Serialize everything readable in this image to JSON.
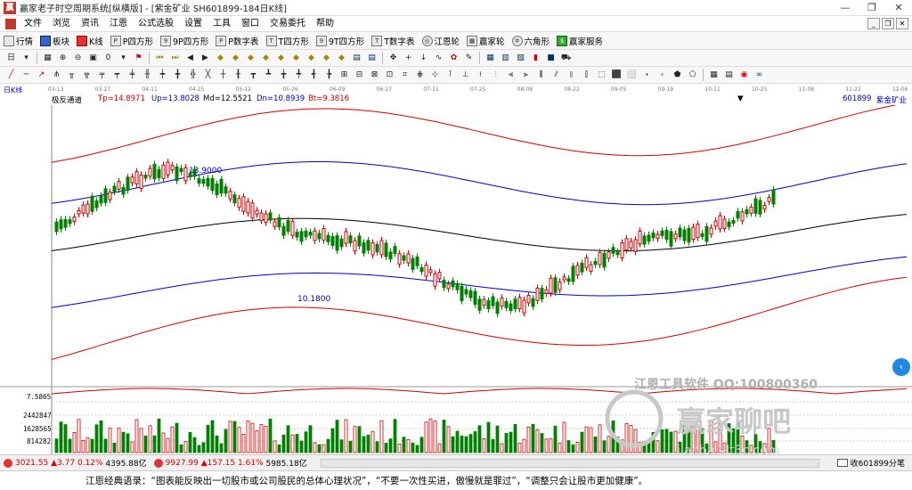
{
  "window": {
    "title": "赢家老子时空周期系统[纵横版] - [紫金矿业  SH601899-184日K线]",
    "app_logo": "赢",
    "buttons": [
      "—",
      "❐",
      "✕"
    ]
  },
  "menu": {
    "items": [
      "文件",
      "浏览",
      "资讯",
      "江恩",
      "公式选股",
      "设置",
      "工具",
      "窗口",
      "交易委托",
      "帮助"
    ],
    "mdi_buttons": [
      "_",
      "❐",
      "✕"
    ]
  },
  "toolbar1": {
    "items": [
      {
        "label": "行情",
        "icon": "grid-icon"
      },
      {
        "label": "板块",
        "icon": "block-icon"
      },
      {
        "label": "K线",
        "icon": "kline-icon"
      },
      {
        "label": "P四方形",
        "icon": "square-icon"
      },
      {
        "label": "9P四方形",
        "icon": "square9-icon"
      },
      {
        "label": "P数字表",
        "icon": "table-icon"
      },
      {
        "label": "T四方形",
        "icon": "tsquare-icon"
      },
      {
        "label": "9T四方形",
        "icon": "tsquare9-icon"
      },
      {
        "label": "T数字表",
        "icon": "ttable-icon"
      },
      {
        "label": "江恩轮",
        "icon": "wheel-icon"
      },
      {
        "label": "赢家轮",
        "icon": "wheel2-icon"
      },
      {
        "label": "六角形",
        "icon": "hexagon-icon"
      },
      {
        "label": "赢家服务",
        "icon": "dollar-icon"
      }
    ]
  },
  "toolbar2": {
    "first": "日",
    "second": "0"
  },
  "datebar": {
    "label": "日K线",
    "ticks": [
      "03-13",
      "03-27",
      "04-11",
      "04-25",
      "05-12",
      "05-26",
      "06-09",
      "06-27",
      "07-11",
      "07-25",
      "08-08",
      "08-22",
      "09-05",
      "09-19",
      "10-11",
      "10-25",
      "11-08",
      "11-22",
      "12-06"
    ]
  },
  "info": {
    "indicator": "极反通道",
    "tp": "Tp=14.8971",
    "up": "Up=13.8028",
    "md": "Md=12.5521",
    "dn": "Dn=10.8939",
    "bt": "Bt=9.3816",
    "code": "601899",
    "name": "紫金矿业"
  },
  "chart_data": {
    "type": "candlestick",
    "annotations": {
      "high": "13.9000",
      "low": "10.1800",
      "sub_label": "7.5865"
    },
    "volume_ticks": [
      "2442847",
      "1628565",
      "814282"
    ],
    "watermark1": "江恩工具软件  QQ:100800360",
    "watermark2": "赢家聊吧",
    "watermark3": "jiaoba.ylt3c.com",
    "colors": {
      "up": "#d00000",
      "down": "#008000",
      "upper_band": "#cc0000",
      "mid_band": "#0000cc",
      "center": "#000000"
    }
  },
  "status": {
    "idx1_value": "3021.55",
    "idx1_change": "▲3.77",
    "idx1_pct": "0.12%",
    "idx1_amount": "4395.88亿",
    "idx2_value": "9927.99",
    "idx2_change": "▲157.15",
    "idx2_pct": "1.61%",
    "idx2_amount": "5985.18亿",
    "message": "收601899分笔"
  },
  "quote": "江恩经典语录：“图表能反映出一切股市或公司股民的总体心理状况”，“不要一次性买进，傲慢就是罪过”，“调整只会让股市更加健康”。"
}
